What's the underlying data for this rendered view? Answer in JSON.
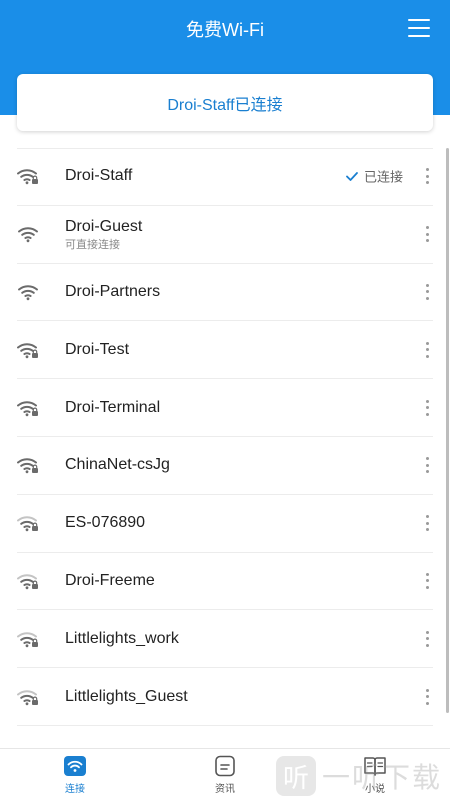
{
  "header": {
    "title": "免费Wi-Fi",
    "menu_icon": "menu-icon",
    "background": "#1a8ee8"
  },
  "status": {
    "text": "Droi-Staff已连接"
  },
  "networks": [
    {
      "ssid": "Droi-Staff",
      "sub": "",
      "status": "已连接",
      "icon": "wifi-locked-icon"
    },
    {
      "ssid": "Droi-Guest",
      "sub": "可直接连接",
      "status": "",
      "icon": "wifi-open-icon"
    },
    {
      "ssid": "Droi-Partners",
      "sub": "",
      "status": "",
      "icon": "wifi-open-icon"
    },
    {
      "ssid": "Droi-Test",
      "sub": "",
      "status": "",
      "icon": "wifi-locked-icon"
    },
    {
      "ssid": "Droi-Terminal",
      "sub": "",
      "status": "",
      "icon": "wifi-locked-icon"
    },
    {
      "ssid": "ChinaNet-csJg",
      "sub": "",
      "status": "",
      "icon": "wifi-locked-icon"
    },
    {
      "ssid": "ES-076890",
      "sub": "",
      "status": "",
      "icon": "wifi-locked-icon"
    },
    {
      "ssid": "Droi-Freeme",
      "sub": "",
      "status": "",
      "icon": "wifi-locked-icon"
    },
    {
      "ssid": "Littlelights_work",
      "sub": "",
      "status": "",
      "icon": "wifi-locked-icon"
    },
    {
      "ssid": "Littlelights_Guest",
      "sub": "",
      "status": "",
      "icon": "wifi-locked-icon"
    }
  ],
  "bottom_nav": {
    "items": [
      {
        "label": "连接",
        "icon": "wifi-tab-icon",
        "active": true
      },
      {
        "label": "资讯",
        "icon": "news-icon",
        "active": false
      },
      {
        "label": "小说",
        "icon": "book-icon",
        "active": false
      }
    ]
  },
  "watermark": {
    "logo_char": "听",
    "text": "一听下载"
  },
  "colors": {
    "accent": "#1a7fd0",
    "header": "#1a8ee8"
  }
}
